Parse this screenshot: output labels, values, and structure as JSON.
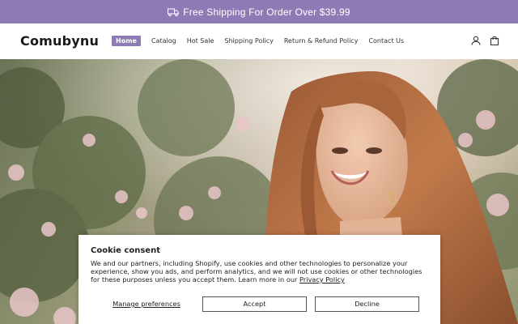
{
  "announcement": {
    "text": "Free Shipping For Order Over $39.99",
    "icon": "truck-icon"
  },
  "header": {
    "logo": "Comubynu",
    "nav": [
      "Home",
      "Catalog",
      "Hot Sale",
      "Shipping Policy",
      "Return & Refund Policy",
      "Contact Us"
    ],
    "active_nav": "Home",
    "icons": [
      "account-icon",
      "cart-icon"
    ]
  },
  "hero": {
    "image": "woman-smiling-in-rose-garden"
  },
  "cookie": {
    "title": "Cookie consent",
    "body": "We and our partners, including Shopify, use cookies and other technologies to personalize your experience, show you ads, and perform analytics, and we will not use cookies or other technologies for these purposes unless you accept them. Learn more in our ",
    "link": "Privacy Policy",
    "manage": "Manage preferences",
    "accept": "Accept",
    "decline": "Decline"
  },
  "colors": {
    "accent": "#8e7bb5"
  }
}
